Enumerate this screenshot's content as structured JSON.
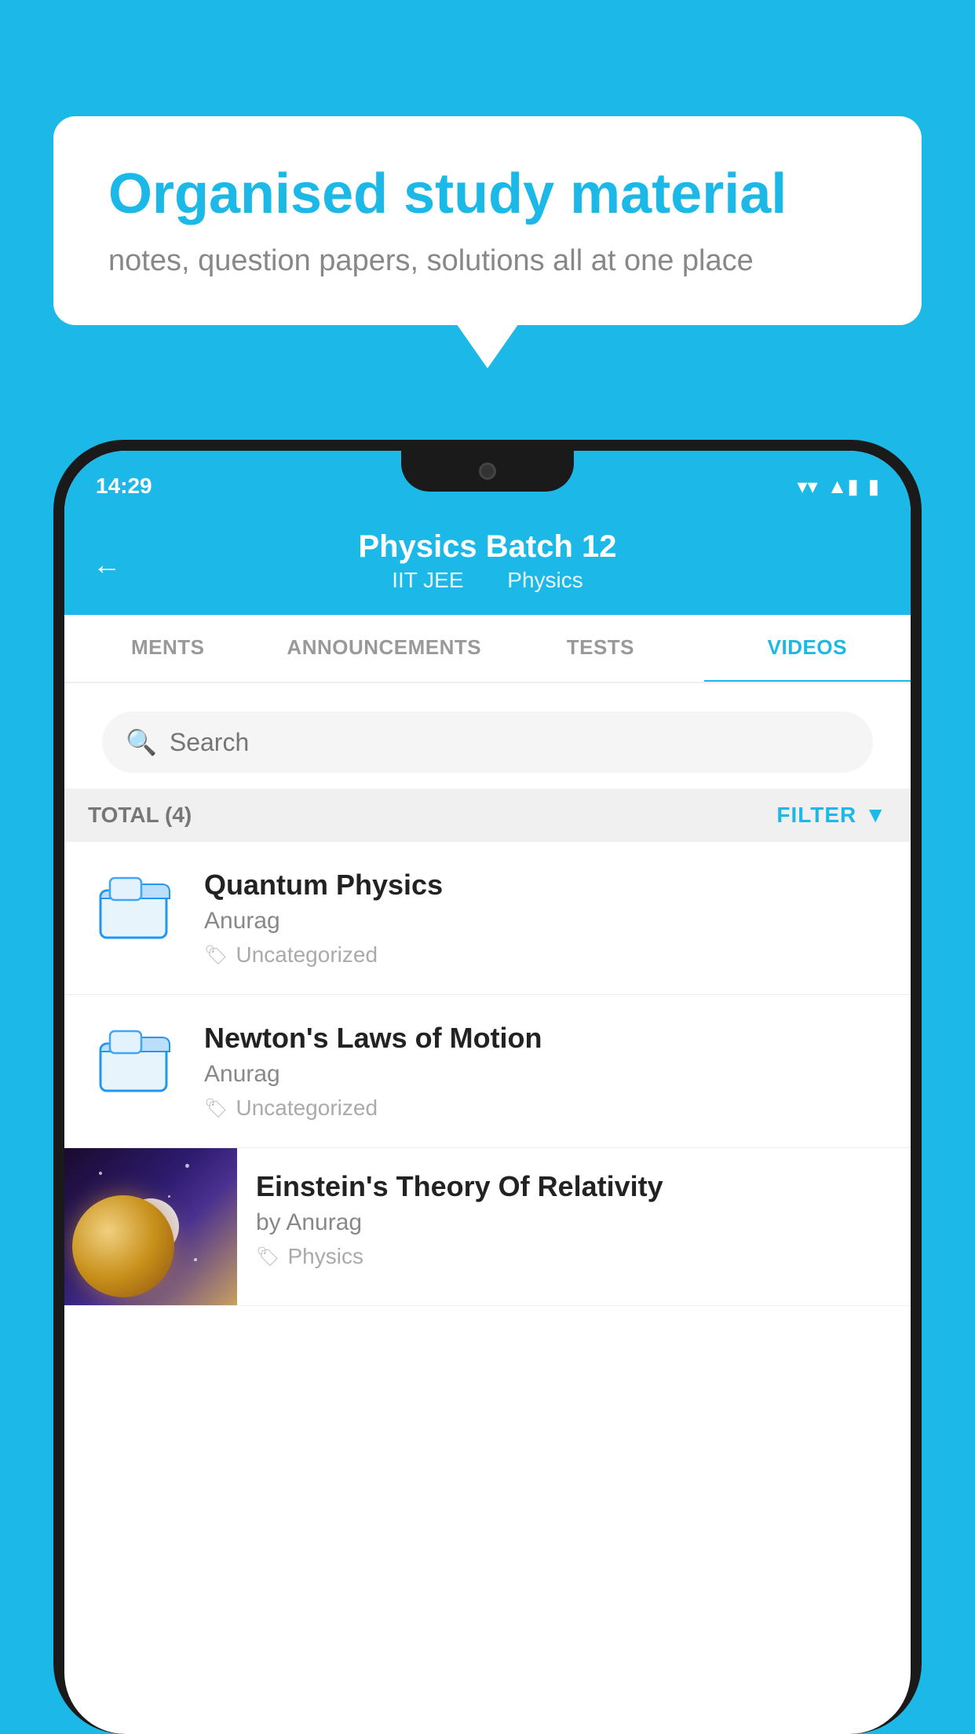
{
  "background_color": "#1BB8E8",
  "speech_bubble": {
    "title": "Organised study material",
    "subtitle": "notes, question papers, solutions all at one place"
  },
  "phone": {
    "status_bar": {
      "time": "14:29",
      "wifi": "▼",
      "signal": "▲",
      "battery": "▮"
    },
    "header": {
      "title": "Physics Batch 12",
      "subtitle_part1": "IIT JEE",
      "subtitle_part2": "Physics",
      "back_label": "←"
    },
    "tabs": [
      {
        "label": "MENTS",
        "active": false
      },
      {
        "label": "ANNOUNCEMENTS",
        "active": false
      },
      {
        "label": "TESTS",
        "active": false
      },
      {
        "label": "VIDEOS",
        "active": true
      }
    ],
    "search": {
      "placeholder": "Search"
    },
    "filter_bar": {
      "total_label": "TOTAL (4)",
      "filter_label": "FILTER"
    },
    "videos": [
      {
        "title": "Quantum Physics",
        "author": "Anurag",
        "tag": "Uncategorized",
        "type": "folder"
      },
      {
        "title": "Newton's Laws of Motion",
        "author": "Anurag",
        "tag": "Uncategorized",
        "type": "folder"
      },
      {
        "title": "Einstein's Theory Of Relativity",
        "author": "by Anurag",
        "tag": "Physics",
        "type": "video"
      }
    ]
  }
}
